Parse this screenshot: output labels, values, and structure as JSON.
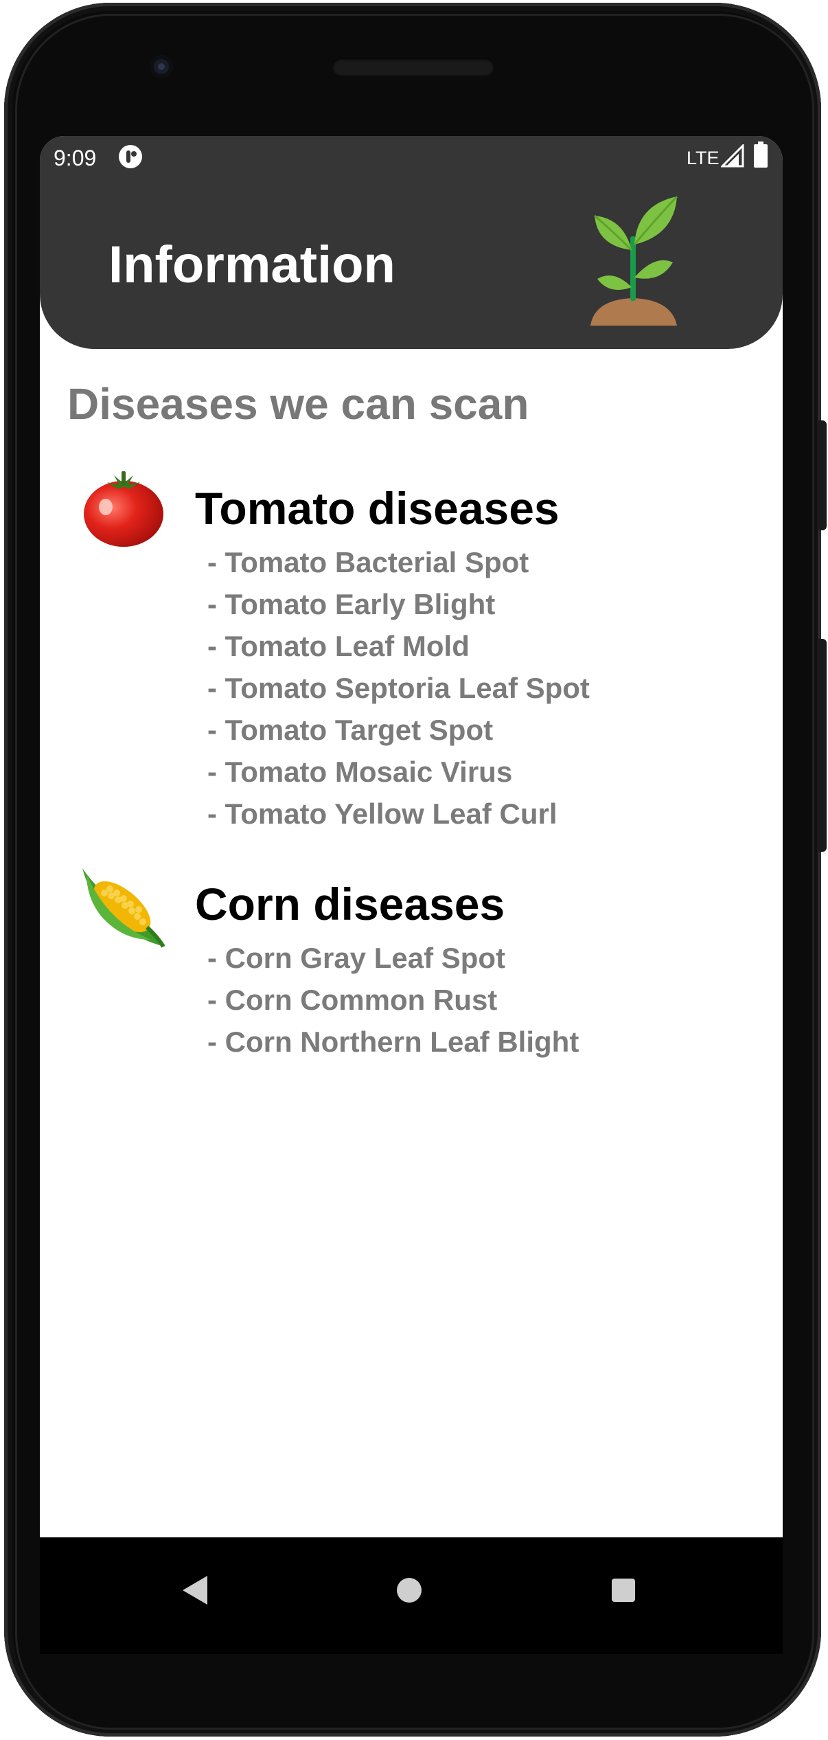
{
  "status_bar": {
    "time": "9:09",
    "network": "LTE"
  },
  "app_bar": {
    "title": "Information",
    "icon": "plant-sprout-icon"
  },
  "content": {
    "heading": "Diseases we can scan",
    "categories": [
      {
        "title": "Tomato diseases",
        "icon": "tomato-icon",
        "diseases": [
          "- Tomato Bacterial Spot",
          "- Tomato Early Blight",
          "- Tomato Leaf Mold",
          "- Tomato Septoria Leaf Spot",
          "- Tomato Target Spot",
          "- Tomato Mosaic Virus",
          "- Tomato Yellow Leaf Curl"
        ]
      },
      {
        "title": "Corn diseases",
        "icon": "corn-icon",
        "diseases": [
          "- Corn Gray Leaf Spot",
          "- Corn Common Rust",
          "- Corn Northern Leaf Blight"
        ]
      }
    ]
  },
  "navigation_bar": {
    "buttons": [
      "back-icon",
      "home-icon",
      "recents-icon"
    ]
  },
  "colors": {
    "app_bar_background": "#363636",
    "heading_gray": "#787878",
    "list_gray": "#7b7b7b",
    "leaf_green": "#7dc242",
    "soil_brown": "#b07a4f"
  }
}
